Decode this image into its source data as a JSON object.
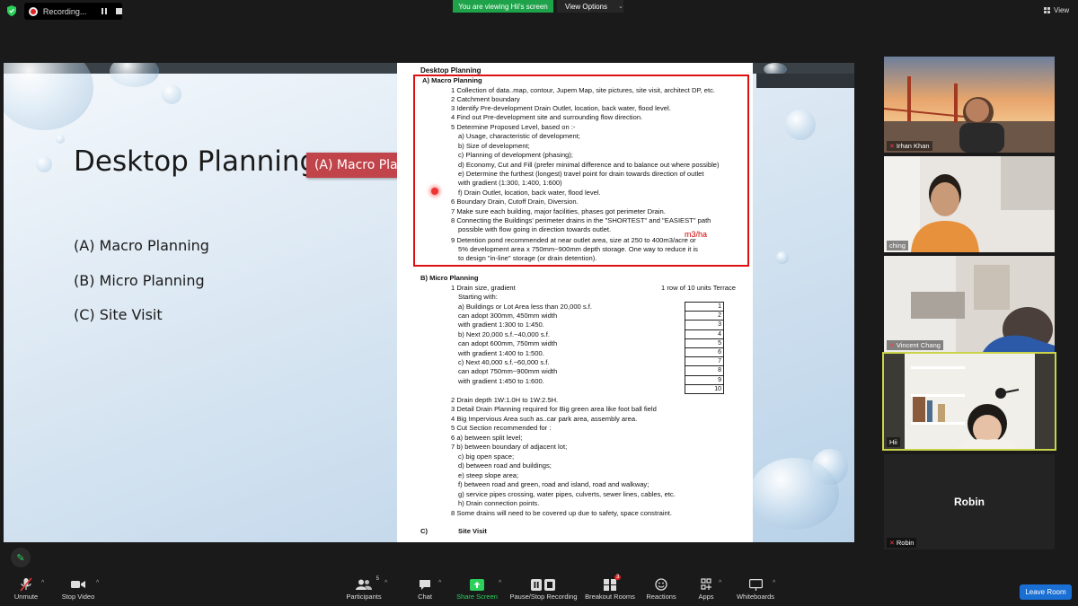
{
  "top": {
    "recording_label": "Recording...",
    "viewing_label": "You are viewing Hii's screen",
    "view_options_label": "View Options",
    "view_label": "View"
  },
  "slide": {
    "title": "Desktop Planning",
    "callout": "(A) Macro Planning",
    "bullets": [
      "(A) Macro Planning",
      "(B) Micro Planning",
      "(C) Site Visit"
    ]
  },
  "doc": {
    "header": "Desktop Planning",
    "lines": [
      "A)  Macro Planning",
      "1  Collection of data..map, contour, Jupem Map, site pictures, site visit, architect DP, etc.",
      "2  Catchment boundary",
      "3  Identify Pre-development Drain Outlet, location, back water, flood level.",
      "4  Find out Pre-development site and surrounding flow direction.",
      "5  Determine Proposed Level, based on :-",
      "a)  Usage, characteristic of development;",
      "b)  Size of development;",
      "c)  Planning of development (phasing);",
      "d)  Economy, Cut and Fill (prefer minimal difference and to balance out where possible)",
      "e)  Determine the furthest (longest) travel point for drain towards direction of outlet",
      "with gradient (1:300, 1:400, 1:600)",
      "f)  Drain Outlet, location, back water, flood level.",
      "6  Boundary Drain, Cutoff Drain, Diversion.",
      "7  Make sure each building, major facilities, phases got perimeter Drain.",
      "8  Connecting the Buildings' perimeter drains in the \"SHORTEST\" and \"EASIEST\" path",
      "possible with flow going in direction towards outlet.",
      "9  Detention pond recommended at near outlet area, size at 250 to 400m3/acre or",
      "5% development area x 750mm~900mm depth storage.  One way to reduce it is",
      "to design \"in-line\" storage (or drain detention).",
      "B)  Micro Planning",
      "1  Drain size, gradient",
      "Starting with:",
      "a)  Buildings or Lot Area less than 20,000 s.f.",
      "can adopt 300mm, 450mm width",
      "with gradient 1:300 to 1:450.",
      "b)  Next 20,000 s.f.~40,000 s.f.",
      "can adopt 600mm, 750mm width",
      "with gradient 1:400 to 1:500.",
      "c)  Next 40,000 s.f.~60,000 s.f.",
      "can adopt 750mm~900mm width",
      "with gradient 1:450 to 1:600.",
      "2  Drain depth 1W:1.0H to 1W:2.5H.",
      "3  Detail Drain Planning required for Big green area like foot ball field",
      "4  Big Impervious Area such as..car park area, assembly area.",
      "5  Cut Section recommended for :",
      "6  a)  between split level;",
      "7  b)  between boundary of adjacent lot;",
      "c)  big open space;",
      "d)  between road and buildings;",
      "e)  steep slope area;",
      "f)  between road and green, road and island, road and walkway;",
      "g)  service pipes crossing, water pipes, culverts, sewer lines, cables, etc.",
      "h)  Drain connection points.",
      "8  Some drains will need to be covered up due to safety, space constraint.",
      "C)",
      "Site Visit"
    ],
    "terrace_label": "1 row of 10 units Terrace",
    "annotation": "m3/ha",
    "table_numbers": [
      "1",
      "2",
      "3",
      "4",
      "5",
      "6",
      "7",
      "8",
      "9",
      "10"
    ]
  },
  "participants": [
    {
      "name": "Irhan Khan",
      "muted": true
    },
    {
      "name": "ching",
      "muted": false
    },
    {
      "name": "Vincent Chang",
      "muted": true
    },
    {
      "name": "Hii",
      "muted": false
    },
    {
      "name": "Robin",
      "muted": true
    }
  ],
  "toolbar": {
    "unmute": "Unmute",
    "stop_video": "Stop Video",
    "participants": "Participants",
    "participants_count": "5",
    "chat": "Chat",
    "share_screen": "Share Screen",
    "pause_recording": "Pause/Stop Recording",
    "breakout_rooms": "Breakout Rooms",
    "breakout_badge": "3",
    "reactions": "Reactions",
    "apps": "Apps",
    "whiteboards": "Whiteboards",
    "leave_room": "Leave Room"
  },
  "colors": {
    "accent_green": "#1fa34a",
    "leave_blue": "#1a6fd4",
    "callout_red": "#c0444a",
    "box_red": "#d11111"
  }
}
